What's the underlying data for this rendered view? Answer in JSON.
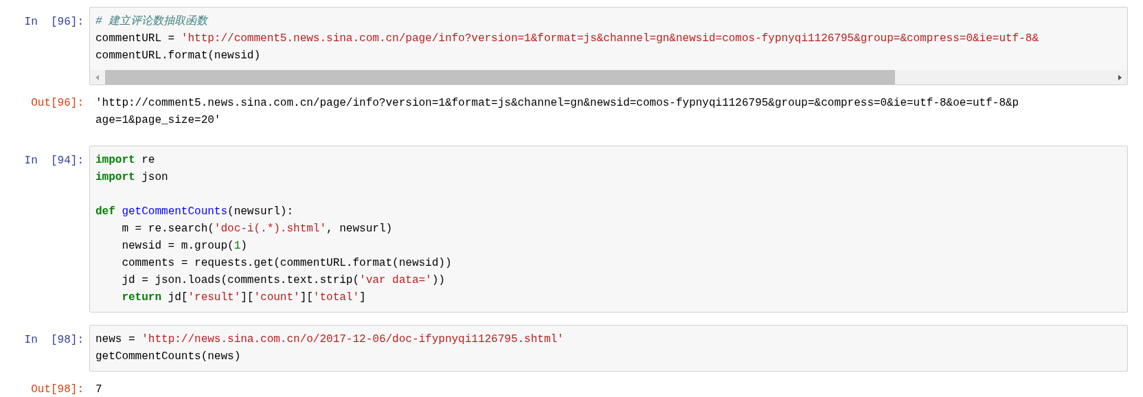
{
  "cells": [
    {
      "prompt": "In  [96]:",
      "scrollbar": true,
      "lines": [
        {
          "tokens": [
            {
              "kind": "comment",
              "text": "# 建立评论数抽取函数"
            }
          ]
        },
        {
          "tokens": [
            {
              "kind": "plain",
              "text": "commentURL = "
            },
            {
              "kind": "string",
              "text": "'http://comment5.news.sina.com.cn/page/info?version=1&format=js&channel=gn&newsid=comos-fypnyqi1126795&group=&compress=0&ie=utf-8&"
            }
          ]
        },
        {
          "tokens": [
            {
              "kind": "plain",
              "text": "commentURL.format(newsid)"
            }
          ]
        }
      ],
      "output": {
        "prompt": "Out[96]:",
        "lines": [
          "'http://comment5.news.sina.com.cn/page/info?version=1&format=js&channel=gn&newsid=comos-fypnyqi1126795&group=&compress=0&ie=utf-8&oe=utf-8&p",
          "age=1&page_size=20'"
        ]
      }
    },
    {
      "prompt": "In  [94]:",
      "scrollbar": false,
      "lines": [
        {
          "tokens": [
            {
              "kind": "keyword",
              "text": "import"
            },
            {
              "kind": "plain",
              "text": " re"
            }
          ]
        },
        {
          "tokens": [
            {
              "kind": "keyword",
              "text": "import"
            },
            {
              "kind": "plain",
              "text": " json"
            }
          ]
        },
        {
          "blank_before": true,
          "tokens": [
            {
              "kind": "keyword",
              "text": "def"
            },
            {
              "kind": "name",
              "text": " getCommentCounts"
            },
            {
              "kind": "plain",
              "text": "(newsurl):"
            }
          ]
        },
        {
          "tokens": [
            {
              "kind": "plain",
              "text": "    m = re.search("
            },
            {
              "kind": "string",
              "text": "'doc-i(.*).shtml'"
            },
            {
              "kind": "plain",
              "text": ", newsurl)"
            }
          ]
        },
        {
          "tokens": [
            {
              "kind": "plain",
              "text": "    newsid = m.group("
            },
            {
              "kind": "number",
              "text": "1"
            },
            {
              "kind": "plain",
              "text": ")"
            }
          ]
        },
        {
          "tokens": [
            {
              "kind": "plain",
              "text": "    comments = requests.get(commentURL.format(newsid))"
            }
          ]
        },
        {
          "tokens": [
            {
              "kind": "plain",
              "text": "    jd = json.loads(comments.text.strip("
            },
            {
              "kind": "string",
              "text": "'var data='"
            },
            {
              "kind": "plain",
              "text": "))"
            }
          ]
        },
        {
          "tokens": [
            {
              "kind": "keyword",
              "text": "    return"
            },
            {
              "kind": "plain",
              "text": " jd["
            },
            {
              "kind": "string",
              "text": "'result'"
            },
            {
              "kind": "plain",
              "text": "]["
            },
            {
              "kind": "string",
              "text": "'count'"
            },
            {
              "kind": "plain",
              "text": "]["
            },
            {
              "kind": "string",
              "text": "'total'"
            },
            {
              "kind": "plain",
              "text": "]"
            }
          ]
        }
      ]
    },
    {
      "prompt": "In  [98]:",
      "scrollbar": false,
      "lines": [
        {
          "tokens": [
            {
              "kind": "plain",
              "text": "news = "
            },
            {
              "kind": "string",
              "text": "'http://news.sina.com.cn/o/2017-12-06/doc-ifypnyqi1126795.shtml'"
            }
          ]
        },
        {
          "tokens": [
            {
              "kind": "plain",
              "text": "getCommentCounts(news)"
            }
          ]
        }
      ],
      "output": {
        "prompt": "Out[98]:",
        "lines": [
          "7"
        ]
      }
    }
  ]
}
